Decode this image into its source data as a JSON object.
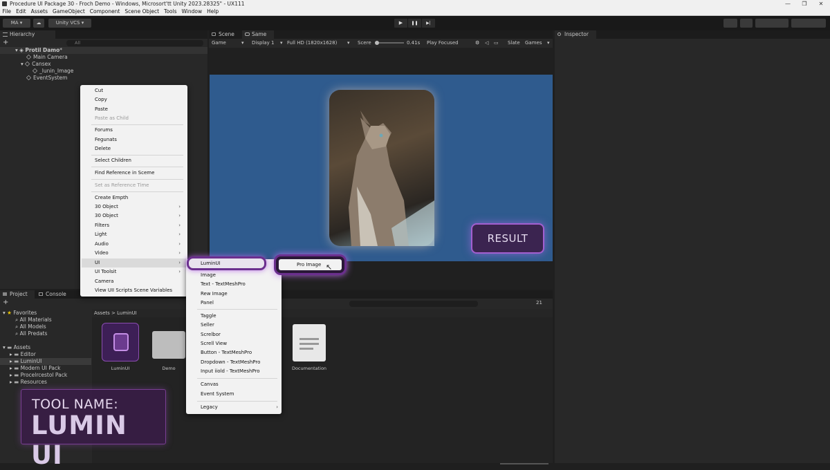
{
  "window": {
    "title": "Procedure UI Package 30 - Froch Demo - Windows, Microsort'tt Unity 2023.28325\" - UX111",
    "min": "—",
    "max": "❐",
    "close": "✕"
  },
  "menu": [
    "File",
    "Edit",
    "Assets",
    "GameObject",
    "Component",
    "Scene Object",
    "Tools",
    "Window",
    "Help"
  ],
  "toolbar": {
    "account": "MA",
    "account_caret": "▾",
    "cloud": "☁",
    "vcs": "Unity VCS",
    "vcs_caret": "▾",
    "play": "▶",
    "pause": "❚❚",
    "step": "▶|"
  },
  "hierarchy": {
    "tab": "Hierarchy",
    "search_placeholder": "All",
    "scene": "Protil Damo",
    "scene_mark": "*",
    "items": [
      "Main Camera",
      "Cansex",
      "_lunin_Image",
      "EventSystem"
    ]
  },
  "scene_tab": "Scene",
  "game_tab": "Same",
  "inspector_tab": "Inspector",
  "game_bar": {
    "mode": "Game",
    "display": "Display 1",
    "resolution": "Full HD (1820x1628)",
    "scale_label": "Scere",
    "scale_value": "0.41s",
    "play_focused": "Play Focused",
    "stats": "Slate",
    "gizmos": "Games"
  },
  "context_menu": {
    "items": [
      {
        "label": "Cut",
        "disabled": false
      },
      {
        "label": "Copy",
        "disabled": false
      },
      {
        "label": "Paste",
        "disabled": false
      },
      {
        "label": "Paste as Child",
        "disabled": true
      },
      {
        "label": "Forums",
        "disabled": false
      },
      {
        "label": "Fegunats",
        "disabled": false
      },
      {
        "label": "Delete",
        "disabled": false
      },
      {
        "label": "Select Children",
        "disabled": false
      },
      {
        "label": "Find Reference in Sceme",
        "disabled": false
      },
      {
        "label": "Set as Reference Time",
        "disabled": true
      },
      {
        "label": "Create Empth",
        "disabled": false
      },
      {
        "label": "30 Object",
        "disabled": false,
        "sub": true
      },
      {
        "label": "30 Object",
        "disabled": false,
        "sub": true
      },
      {
        "label": "Filters",
        "disabled": false,
        "sub": true
      },
      {
        "label": "Light",
        "disabled": false,
        "sub": true
      },
      {
        "label": "Audio",
        "disabled": false,
        "sub": true
      },
      {
        "label": "Video",
        "disabled": false,
        "sub": true
      },
      {
        "label": "UI",
        "disabled": false,
        "sub": true
      },
      {
        "label": "UI Toolsit",
        "disabled": false,
        "sub": true
      },
      {
        "label": "Camera",
        "disabled": false
      },
      {
        "label": "View UII Scripts Scene Variables",
        "disabled": false
      }
    ],
    "submenu_arrow": "›"
  },
  "ui_submenu": {
    "highlight": "LuminUI",
    "items": [
      "Image",
      "Text - TextMeshPro",
      "Rew Image",
      "Panel",
      "Taggle",
      "Seller",
      "Screlbor",
      "Screll View",
      "Button - TextMeshPro",
      "Dropdown - TextMeshPro",
      "Input iiold - TextMeshPro",
      "Canvas",
      "Event System",
      "Legacy"
    ]
  },
  "lumin_submenu": {
    "item": "Pro Image"
  },
  "result_button": "RESULT",
  "project": {
    "tab": "Project",
    "console_tab": "Console",
    "favorites": "Favorites",
    "fav_items": [
      "All Materials",
      "All Models",
      "All Predats"
    ],
    "assets": "Assets",
    "asset_folders": [
      "Editor",
      "LuminUI",
      "Modern UI Pack",
      "Procelrcestol Pack",
      "Resources"
    ],
    "breadcrumb_root": "Assets",
    "breadcrumb_sep": ">",
    "breadcrumb_leaf": "LuminUI",
    "files": [
      "LuminUI",
      "Demo",
      "Documentation"
    ],
    "hidden_count": "21"
  },
  "tool_card": {
    "line1": "TOOL NAME:",
    "line2": "LUMIN UI"
  },
  "colors": {
    "accent_purple": "#a35fd0",
    "game_bg": "#2e5a8c",
    "panel": "#282828"
  }
}
